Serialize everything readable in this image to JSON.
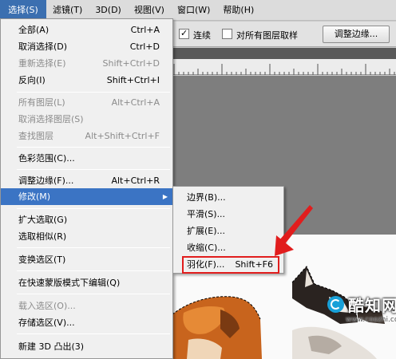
{
  "menubar": {
    "items": [
      {
        "label": "选择(S)",
        "active": true
      },
      {
        "label": "滤镜(T)"
      },
      {
        "label": "3D(D)"
      },
      {
        "label": "视图(V)"
      },
      {
        "label": "窗口(W)"
      },
      {
        "label": "帮助(H)"
      }
    ]
  },
  "options": {
    "contiguous_label": "连续",
    "contiguous_checked": true,
    "sample_all_label": "对所有图层取样",
    "sample_all_checked": false,
    "refine_edge_button": "调整边缘..."
  },
  "select_menu": {
    "items": [
      {
        "label": "全部(A)",
        "shortcut": "Ctrl+A",
        "disabled": false
      },
      {
        "label": "取消选择(D)",
        "shortcut": "Ctrl+D",
        "disabled": false
      },
      {
        "label": "重新选择(E)",
        "shortcut": "Shift+Ctrl+D",
        "disabled": true
      },
      {
        "label": "反向(I)",
        "shortcut": "Shift+Ctrl+I",
        "disabled": false
      },
      {
        "label": "所有图层(L)",
        "shortcut": "Alt+Ctrl+A",
        "disabled": true
      },
      {
        "label": "取消选择图层(S)",
        "shortcut": "",
        "disabled": true
      },
      {
        "label": "查找图层",
        "shortcut": "Alt+Shift+Ctrl+F",
        "disabled": true
      },
      {
        "label": "色彩范围(C)...",
        "shortcut": "",
        "disabled": false
      },
      {
        "label": "调整边缘(F)...",
        "shortcut": "Alt+Ctrl+R",
        "disabled": false
      },
      {
        "label": "修改(M)",
        "shortcut": "",
        "disabled": false,
        "highlighted": true,
        "has_submenu": true
      },
      {
        "label": "扩大选取(G)",
        "shortcut": "",
        "disabled": false
      },
      {
        "label": "选取相似(R)",
        "shortcut": "",
        "disabled": false
      },
      {
        "label": "变换选区(T)",
        "shortcut": "",
        "disabled": false
      },
      {
        "label": "在快速蒙版模式下编辑(Q)",
        "shortcut": "",
        "disabled": false
      },
      {
        "label": "载入选区(O)...",
        "shortcut": "",
        "disabled": true
      },
      {
        "label": "存储选区(V)...",
        "shortcut": "",
        "disabled": false
      },
      {
        "label": "新建 3D 凸出(3)",
        "shortcut": "",
        "disabled": false
      }
    ]
  },
  "modify_submenu": {
    "items": [
      {
        "label": "边界(B)...",
        "shortcut": ""
      },
      {
        "label": "平滑(S)...",
        "shortcut": ""
      },
      {
        "label": "扩展(E)...",
        "shortcut": ""
      },
      {
        "label": "收缩(C)...",
        "shortcut": ""
      },
      {
        "label": "羽化(F)...",
        "shortcut": "Shift+F6"
      }
    ]
  },
  "watermark": {
    "name": "酷知网",
    "url": "www.coozhi.com"
  },
  "colors": {
    "menu_highlight": "#3b74c4",
    "annotation_red": "#e11d1d",
    "watermark_blue": "#18a0d8"
  }
}
